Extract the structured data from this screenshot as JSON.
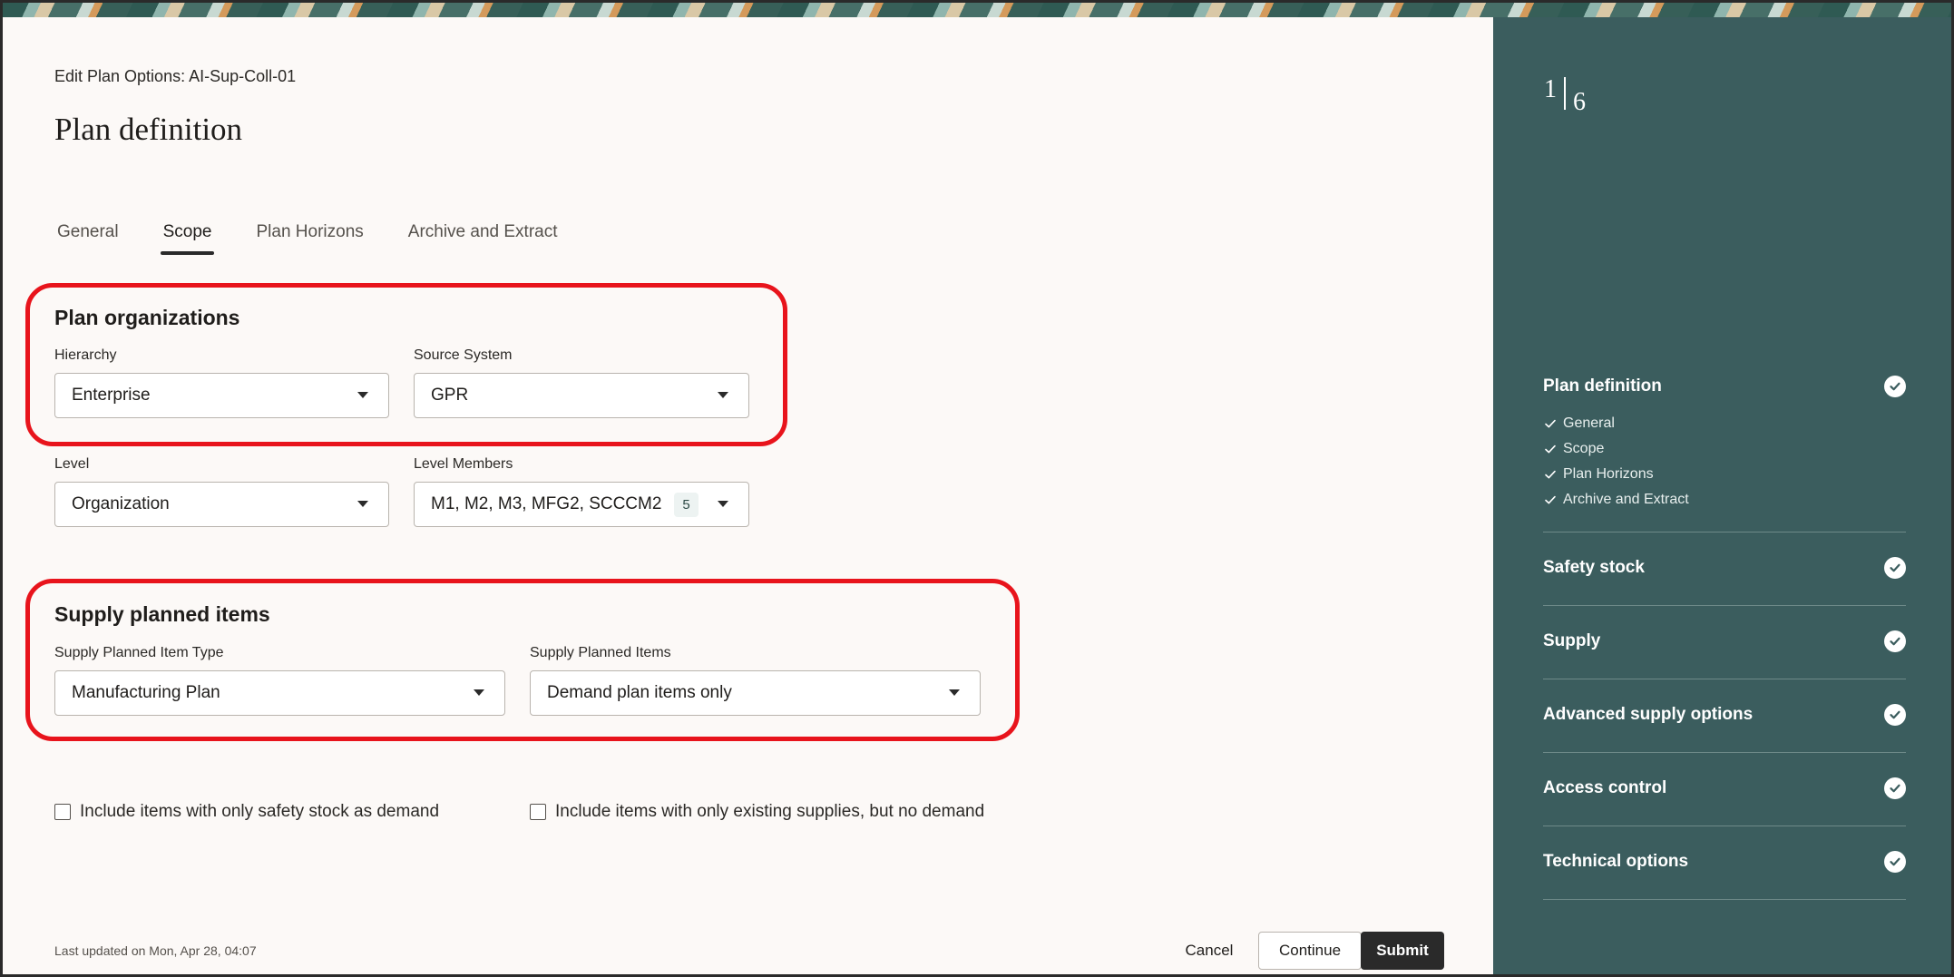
{
  "header": {
    "breadcrumb": "Edit Plan Options: AI-Sup-Coll-01",
    "title": "Plan definition"
  },
  "tabs": [
    {
      "label": "General",
      "active": false
    },
    {
      "label": "Scope",
      "active": true
    },
    {
      "label": "Plan Horizons",
      "active": false
    },
    {
      "label": "Archive and Extract",
      "active": false
    }
  ],
  "plan_organizations": {
    "title": "Plan organizations",
    "hierarchy": {
      "label": "Hierarchy",
      "value": "Enterprise"
    },
    "source_system": {
      "label": "Source System",
      "value": "GPR"
    },
    "level": {
      "label": "Level",
      "value": "Organization"
    },
    "level_members": {
      "label": "Level Members",
      "value": "M1, M2, M3, MFG2, SCCCM2",
      "count": "5"
    }
  },
  "supply_planned_items": {
    "title": "Supply planned items",
    "item_type": {
      "label": "Supply Planned Item Type",
      "value": "Manufacturing Plan"
    },
    "items": {
      "label": "Supply Planned Items",
      "value": "Demand plan items only"
    }
  },
  "checkboxes": {
    "safety_stock": {
      "label": "Include items with only safety stock as demand",
      "checked": false
    },
    "existing_supplies": {
      "label": "Include items with only existing supplies, but no demand",
      "checked": false
    }
  },
  "footer": {
    "last_updated": "Last updated on Mon, Apr 28, 04:07",
    "cancel": "Cancel",
    "continue": "Continue",
    "submit": "Submit"
  },
  "sidebar": {
    "current_step": "1",
    "total_steps": "6",
    "steps": [
      {
        "label": "Plan definition",
        "sub_items": [
          "General",
          "Scope",
          "Plan Horizons",
          "Archive and Extract"
        ]
      },
      {
        "label": "Safety stock"
      },
      {
        "label": "Supply"
      },
      {
        "label": "Advanced supply options"
      },
      {
        "label": "Access control"
      },
      {
        "label": "Technical options"
      }
    ]
  },
  "colors": {
    "highlight": "#e8141c",
    "sidebar_bg": "#3b5d5e",
    "submit_bg": "#2a2a2a",
    "page_bg": "#fcf9f7"
  }
}
